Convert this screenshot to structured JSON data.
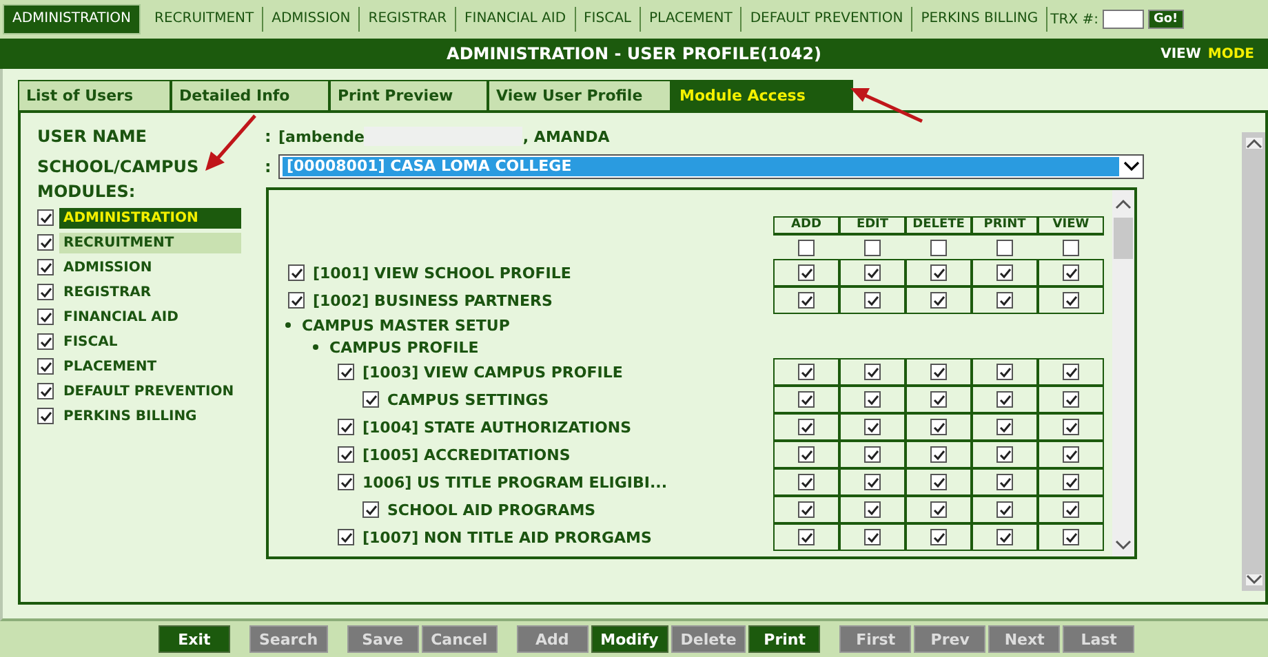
{
  "top_nav": {
    "items": [
      {
        "label": "ADMINISTRATION",
        "selected": true
      },
      {
        "label": "RECRUITMENT",
        "selected": false
      },
      {
        "label": "ADMISSION",
        "selected": false
      },
      {
        "label": "REGISTRAR",
        "selected": false
      },
      {
        "label": "FINANCIAL AID",
        "selected": false
      },
      {
        "label": "FISCAL",
        "selected": false
      },
      {
        "label": "PLACEMENT",
        "selected": false
      },
      {
        "label": "DEFAULT PREVENTION",
        "selected": false
      },
      {
        "label": "PERKINS BILLING",
        "selected": false
      }
    ],
    "trx_label": "TRX #:",
    "go_button": "Go!"
  },
  "title_bar": {
    "title": "ADMINISTRATION - USER PROFILE(1042)",
    "mode_label": "VIEW",
    "mode_word": "MODE"
  },
  "tabs": [
    {
      "label": "List of Users",
      "selected": false
    },
    {
      "label": "Detailed Info",
      "selected": false
    },
    {
      "label": "Print Preview",
      "selected": false
    },
    {
      "label": "View User Profile",
      "selected": false
    },
    {
      "label": "Module Access",
      "selected": true
    }
  ],
  "user_name": {
    "label": "USER NAME",
    "separator": ":",
    "value_start": "[ambende",
    "value_end": ", AMANDA"
  },
  "school": {
    "label": "SCHOOL/CAMPUS",
    "separator": ":",
    "value": "[00008001] CASA LOMA COLLEGE"
  },
  "modules": {
    "label": "MODULES:",
    "items": [
      {
        "label": "ADMINISTRATION",
        "checked": true,
        "selected": true,
        "hovered": false
      },
      {
        "label": "RECRUITMENT",
        "checked": true,
        "selected": false,
        "hovered": true
      },
      {
        "label": "ADMISSION",
        "checked": true,
        "selected": false,
        "hovered": false
      },
      {
        "label": "REGISTRAR",
        "checked": true,
        "selected": false,
        "hovered": false
      },
      {
        "label": "FINANCIAL AID",
        "checked": true,
        "selected": false,
        "hovered": false
      },
      {
        "label": "FISCAL",
        "checked": true,
        "selected": false,
        "hovered": false
      },
      {
        "label": "PLACEMENT",
        "checked": true,
        "selected": false,
        "hovered": false
      },
      {
        "label": "DEFAULT PREVENTION",
        "checked": true,
        "selected": false,
        "hovered": false
      },
      {
        "label": "PERKINS BILLING",
        "checked": true,
        "selected": false,
        "hovered": false
      }
    ]
  },
  "permissions": {
    "columns": [
      {
        "label": "ADD",
        "checked": false
      },
      {
        "label": "EDIT",
        "checked": false
      },
      {
        "label": "DELETE",
        "checked": false
      },
      {
        "label": "PRINT",
        "checked": false
      },
      {
        "label": "VIEW",
        "checked": false
      }
    ],
    "rows": [
      {
        "kind": "item",
        "label": "[1001] VIEW SCHOOL PROFILE",
        "checked": true,
        "perms": [
          true,
          true,
          true,
          true,
          true
        ]
      },
      {
        "kind": "item",
        "label": "[1002] BUSINESS PARTNERS",
        "checked": true,
        "perms": [
          true,
          true,
          true,
          true,
          true
        ]
      },
      {
        "kind": "group",
        "label": "CAMPUS MASTER SETUP",
        "children": [
          {
            "kind": "group",
            "label": "CAMPUS PROFILE",
            "children": [
              {
                "kind": "item",
                "label": "[1003] VIEW CAMPUS PROFILE",
                "checked": true,
                "perms": [
                  true,
                  true,
                  true,
                  true,
                  true
                ],
                "children": [
                  {
                    "kind": "item",
                    "label": "CAMPUS SETTINGS",
                    "checked": true,
                    "perms": [
                      true,
                      true,
                      true,
                      true,
                      true
                    ]
                  }
                ]
              },
              {
                "kind": "item",
                "label": "[1004] STATE AUTHORIZATIONS",
                "checked": true,
                "perms": [
                  true,
                  true,
                  true,
                  true,
                  true
                ]
              },
              {
                "kind": "item",
                "label": "[1005] ACCREDITATIONS",
                "checked": true,
                "perms": [
                  true,
                  true,
                  true,
                  true,
                  true
                ]
              },
              {
                "kind": "item",
                "label": "1006] US TITLE PROGRAM ELIGIBI...",
                "checked": true,
                "perms": [
                  true,
                  true,
                  true,
                  true,
                  true
                ],
                "children": [
                  {
                    "kind": "item",
                    "label": "SCHOOL AID PROGRAMS",
                    "checked": true,
                    "perms": [
                      true,
                      true,
                      true,
                      true,
                      true
                    ]
                  }
                ]
              },
              {
                "kind": "item",
                "label": "[1007] NON TITLE AID PRORGAMS",
                "checked": true,
                "perms": [
                  true,
                  true,
                  true,
                  true,
                  true
                ]
              }
            ]
          }
        ]
      }
    ]
  },
  "buttons": [
    {
      "label": "Exit",
      "disabled": false
    },
    {
      "label": "Search",
      "disabled": true
    },
    {
      "label": "Save",
      "disabled": true
    },
    {
      "label": "Cancel",
      "disabled": true
    },
    {
      "label": "Add",
      "disabled": true
    },
    {
      "label": "Modify",
      "disabled": false
    },
    {
      "label": "Delete",
      "disabled": true
    },
    {
      "label": "Print",
      "disabled": false
    },
    {
      "label": "First",
      "disabled": true
    },
    {
      "label": "Prev",
      "disabled": true
    },
    {
      "label": "Next",
      "disabled": true
    },
    {
      "label": "Last",
      "disabled": true
    }
  ]
}
